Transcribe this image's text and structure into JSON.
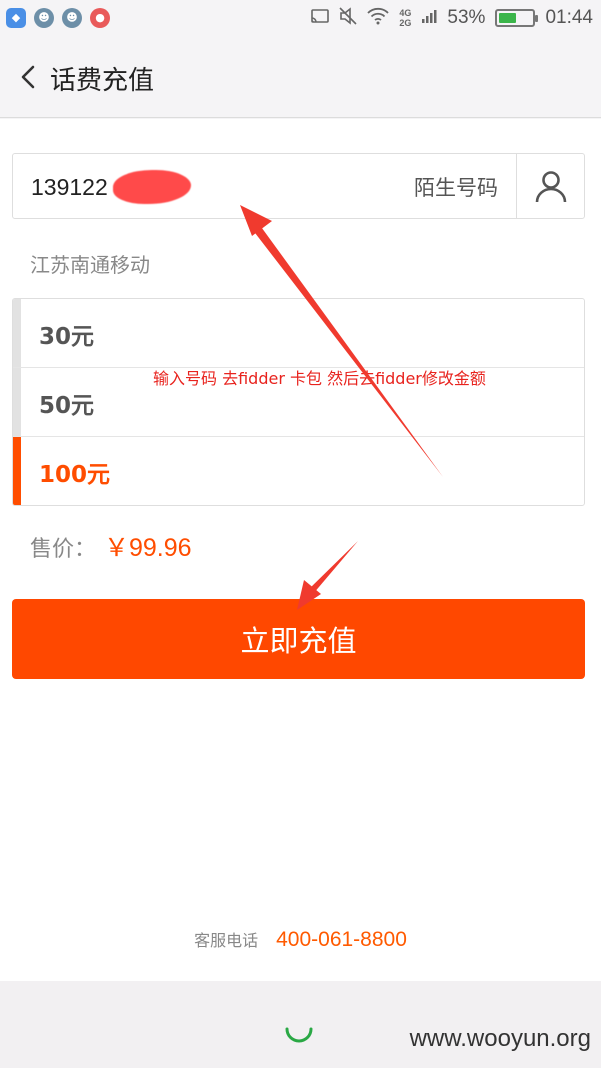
{
  "status_bar": {
    "apps": [
      "shield-app",
      "qq-app",
      "qq-app",
      "weibo-app"
    ],
    "network": [
      "4G",
      "2G"
    ],
    "battery": "53%",
    "battery_level": 0.53,
    "time": "01:44"
  },
  "header": {
    "title": "话费充值"
  },
  "phone": {
    "value": "139122",
    "stranger_label": "陌生号码"
  },
  "carrier": "江苏南通移动",
  "amounts": [
    {
      "label": "30元",
      "selected": false
    },
    {
      "label": "50元",
      "selected": false
    },
    {
      "label": "100元",
      "selected": true
    }
  ],
  "annotation": "输入号码 去fidder 卡包 然后去fidder修改金额",
  "price": {
    "label": "售价：",
    "value": "￥99.96"
  },
  "recharge_button": "立即充值",
  "service": {
    "label": "客服电话",
    "phone": "400-061-8800"
  },
  "watermark": "www.wooyun.org",
  "colors": {
    "accent": "#ff4800",
    "annotation": "#e8231e",
    "spinner": "#2aa845"
  }
}
